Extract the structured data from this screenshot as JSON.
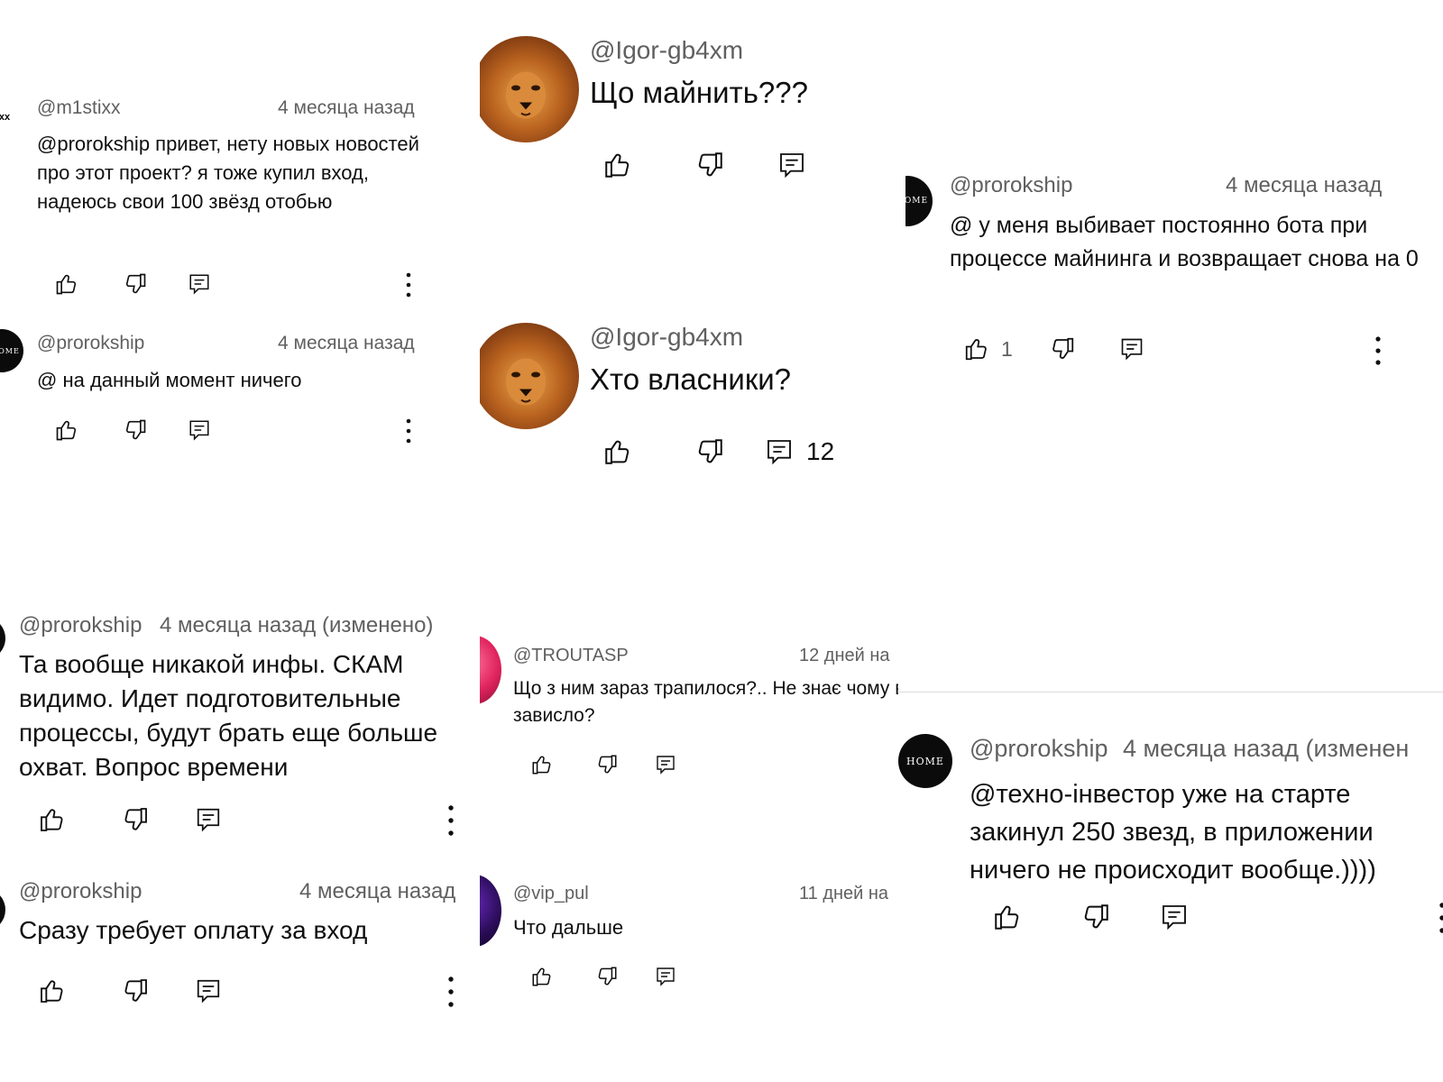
{
  "colors": {
    "text": "#0f0f0f",
    "meta": "#606060",
    "background": "#ffffff"
  },
  "icons": {
    "like": "thumb-up-icon",
    "dislike": "thumb-down-icon",
    "reply": "reply-icon",
    "menu": "more-vert-icon"
  },
  "panels": {
    "p1": {
      "c1": {
        "avatar_text": "stixx",
        "author": "@m1stixx",
        "time": "4 месяца назад",
        "text": "@prorokship привет, нету новых новостей про этот проект? я тоже купил вход, надеюсь свои 100 звёзд отобью"
      },
      "c2": {
        "avatar_text": "OME",
        "author": "@prorokship",
        "time": "4 месяца назад",
        "text": "@ на данный момент ничего"
      }
    },
    "p2": {
      "c1": {
        "author": "@Igor-gb4xm",
        "text": "Що майнить???"
      },
      "c2": {
        "author": "@Igor-gb4xm",
        "text": "Хто власники?",
        "replies": "12"
      }
    },
    "p3": {
      "c1": {
        "avatar_text": "OME",
        "author": "@prorokship",
        "time": "4 месяца назад",
        "text": "@ у меня выбивает постоянно бота при процессе майнинга и возвращает снова на 0",
        "likes": "1"
      }
    },
    "p4": {
      "c1": {
        "author": "@prorokship",
        "time": "4 месяца назад (изменено)",
        "text": "Та вообще никакой инфы. СКАМ видимо. Идет подготовительные процессы, будут брать еще больше охват. Вопрос времени"
      },
      "c2": {
        "author": "@prorokship",
        "time": "4 месяца назад",
        "text": "Сразу требует оплату за вход"
      }
    },
    "p5": {
      "c1": {
        "author": "@TROUTASP",
        "time": "12 дней на",
        "text": "Що з ним зараз трапилося?.. Не знає чому все зависло?"
      },
      "c2": {
        "author": "@vip_pul",
        "time": "11 дней на",
        "text": "Что дальше"
      }
    },
    "p6": {
      "c1": {
        "avatar_text": "HOME",
        "author": "@prorokship",
        "time": "4 месяца назад (изменен",
        "text": "@техно-інвестор уже на старте закинул 250 звезд, в приложении ничего не происходит вообще.))))"
      }
    }
  }
}
